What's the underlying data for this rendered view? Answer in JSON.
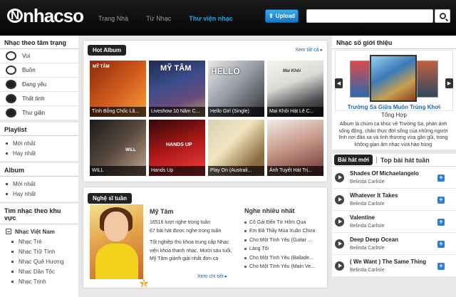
{
  "header": {
    "logo": "nhacso",
    "nav": [
      "Trang Nhà",
      "Từ Nhạc",
      "Thư viện nhạc"
    ],
    "upload_label": "Upload",
    "search_placeholder": ""
  },
  "left": {
    "mood_title": "Nhạc theo tâm trạng",
    "moods": [
      "Vui",
      "Buồn",
      "Đang yêu",
      "Thất tình",
      "Thư giãn"
    ],
    "playlist_title": "Playlist",
    "playlist_items": [
      "Mới nhất",
      "Hay nhất"
    ],
    "album_title": "Album",
    "album_items": [
      "Mới nhất",
      "Hay nhất"
    ],
    "region_title": "Tìm nhạc theo khu vực",
    "region_head": "Nhạc Việt Nam",
    "region_items": [
      "Nhạc Trẻ",
      "Nhạc Trữ Tình",
      "Nhạc Quê Hương",
      "Nhạc Dân Tộc",
      "Nhạc Trịnh"
    ]
  },
  "hot_album": {
    "title": "Hot Album",
    "see_all": "Xem tất cả",
    "albums": [
      {
        "caption": "Tình Bỗng Chốc Lã...",
        "art": "MỸ TÂM"
      },
      {
        "caption": "Liveshow 10 Năm C...",
        "art": "MỸ TÂM"
      },
      {
        "caption": "Hello Girl (Single)",
        "art": "HELLO"
      },
      {
        "caption": "Mai Khôi Hát Lê C...",
        "art": "Mai Khôi"
      },
      {
        "caption": "WILL",
        "art": "WILL"
      },
      {
        "caption": "Hands Up",
        "art": "HANDS UP"
      },
      {
        "caption": "Play On (Australi...",
        "art": ""
      },
      {
        "caption": "Ánh Tuyết Hát Trị...",
        "art": ""
      }
    ]
  },
  "artist_week": {
    "title": "Nghệ sĩ tuần",
    "name": "Mỹ Tâm",
    "stat1": "16516 lượt nghe trong tuần",
    "stat2": "67 bài hát được nghe trong tuần",
    "bio": "Tốt nghiệp thủ khoa trung cấp Nhạc viện khoa thanh nhạc. Mười sáu tuổi, Mỹ Tâm giành giải nhất đơn ca",
    "more": "Xem chi tiết",
    "rank": "1",
    "listen_title": "Nghe nhiều nhất",
    "listen": [
      "Cô Gái Đến Từ Hôm Qua",
      "Em Đã Thấy Mùa Xuân Chưa",
      "Cho Một Tình Yêu (Guitar ...",
      "Làng Tôi",
      "Cho Một Tình Yêu (Ballade...",
      "Cho Một Tình Yêu (Main Ve..."
    ]
  },
  "intro": {
    "title": "Nhạc số giới thiệu",
    "song": "Trường Sa Giữa Muôn Trùng Khơi",
    "artist": "Tổng Hợp",
    "desc": "Album là chùm ca khúc về Trường Sa, phản ánh sống động, chân thực đời sống của những người lính nơi đảo xa và tình thương vừa gần gũi, trong không gian âm nhạc vừa hào hùng"
  },
  "songs_tabs": [
    "Bài hát mới",
    "Top bài hát tuần"
  ],
  "songs": [
    {
      "title": "Shades Of Michaelangelo",
      "artist": "Belinda Carlisle"
    },
    {
      "title": "Whatever It Takes",
      "artist": "Belinda Carlisle"
    },
    {
      "title": "Valentine",
      "artist": "Belinda Carlisle"
    },
    {
      "title": "Deep Deep Ocean",
      "artist": "Belinda Carlisle"
    },
    {
      "title": "( We Want ) The Same Thing",
      "artist": "Belinda Carlisle"
    }
  ]
}
